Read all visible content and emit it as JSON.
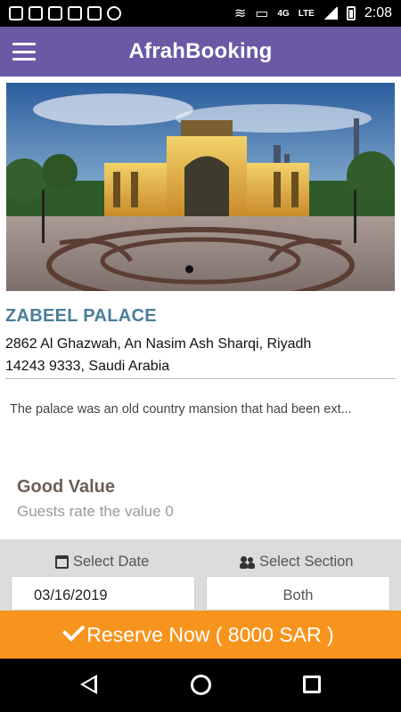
{
  "status_bar": {
    "network": "4G",
    "lte": "LTE",
    "time": "2:08"
  },
  "app_bar": {
    "title": "AfrahBooking",
    "menu_icon": "hamburger-menu-icon"
  },
  "venue": {
    "name": "ZABEEL PALACE",
    "address_line1": "2862 Al Ghazwah, An Nasim Ash Sharqi, Riyadh",
    "address_line2": "14243 9333, Saudi Arabia",
    "description": "The palace was an old country mansion that had been ext..."
  },
  "rating": {
    "title": "Good Value",
    "subtitle": "Guests rate the value 0"
  },
  "booking": {
    "date_label": "Select Date",
    "date_value": "03/16/2019",
    "section_label": "Select Section",
    "section_value": "Both"
  },
  "reserve_button": {
    "label": "Reserve Now ( 8000 SAR )"
  },
  "colors": {
    "app_bar": "#6a5aa6",
    "reserve": "#f7941d",
    "venue_name": "#4a7d98"
  }
}
